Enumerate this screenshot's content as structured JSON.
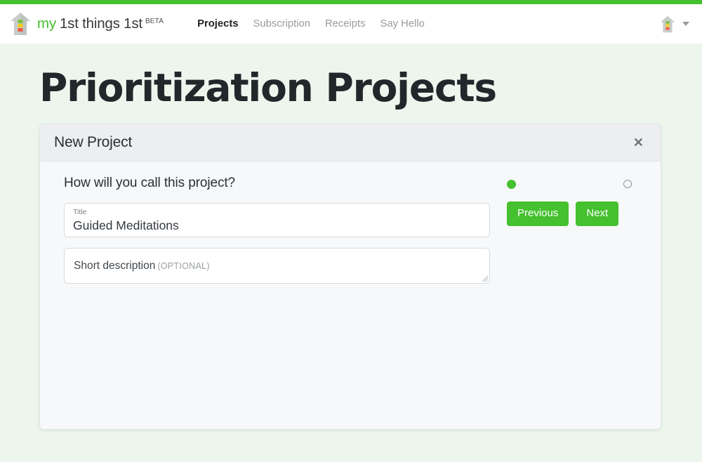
{
  "theme": {
    "brand_green": "#45c02f",
    "page_bg": "#edf6ed",
    "card_bg": "#f7f8f9",
    "card_header_bg": "#eceef0",
    "title_color": "#22272b"
  },
  "header": {
    "logo_icon": "house-logo-icon",
    "brand_my": "my",
    "brand_rest": "1st things 1st",
    "brand_beta": "BETA",
    "nav": [
      {
        "label": "Projects",
        "active": true
      },
      {
        "label": "Subscription",
        "active": false
      },
      {
        "label": "Receipts",
        "active": false
      },
      {
        "label": "Say Hello",
        "active": false
      }
    ],
    "avatar_icon": "house-avatar-icon",
    "caret_icon": "chevron-down-icon"
  },
  "page": {
    "title": "Prioritization Projects"
  },
  "card": {
    "title": "New Project",
    "close_label": "✕",
    "question": "How will you call this project?",
    "title_field": {
      "label": "Title",
      "value": "Guided Meditations",
      "placeholder": "Title"
    },
    "description_field": {
      "placeholder_main": "Short description",
      "placeholder_optional": "(OPTIONAL)",
      "value": ""
    },
    "steps": [
      {
        "name": "step-1",
        "state": "active"
      },
      {
        "name": "step-2",
        "state": "inactive"
      }
    ],
    "buttons": {
      "previous": "Previous",
      "next": "Next"
    }
  }
}
